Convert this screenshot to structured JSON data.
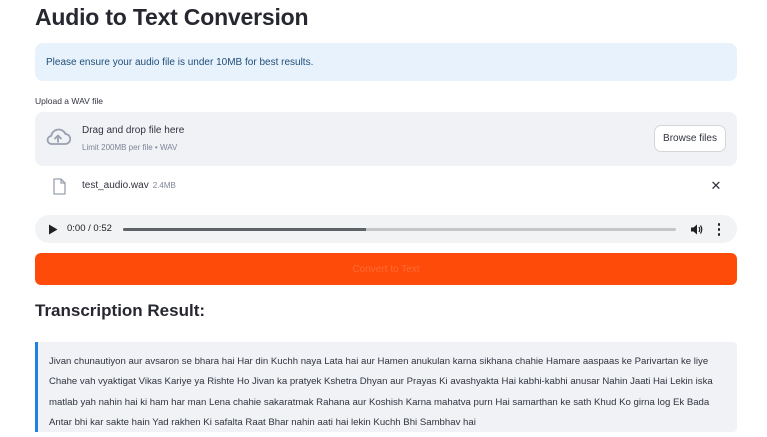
{
  "page": {
    "title": "Audio to Text Conversion",
    "info_message": "Please ensure your audio file is under 10MB for best results."
  },
  "uploader": {
    "label": "Upload a WAV file",
    "drag_text": "Drag and drop file here",
    "limit_text": "Limit 200MB per file • WAV",
    "browse_label": "Browse files",
    "icon": "cloud-upload-icon"
  },
  "file": {
    "name": "test_audio.wav",
    "size": "2.4MB",
    "icon": "file-icon",
    "remove_icon": "close-icon"
  },
  "player": {
    "time": "0:00 / 0:52",
    "progress": 0.44,
    "icons": [
      "play-icon",
      "volume-icon",
      "more-options-icon"
    ]
  },
  "convert": {
    "label": "Convert to Text"
  },
  "result": {
    "heading": "Transcription Result:",
    "text": "Jivan chunautiyon aur avsaron se bhara hai Har din Kuchh naya Lata hai aur Hamen anukulan karna sikhana chahie Hamare aaspaas ke Parivartan ke liye Chahe vah vyaktigat Vikas Kariye ya Rishte Ho Jivan ka pratyek Kshetra Dhyan aur Prayas Ki avashyakta Hai kabhi-kabhi anusar Nahin Jaati Hai Lekin iska matlab yah nahin hai ki ham har man Lena chahie sakaratmak Rahana aur Koshish Karna mahatva purn Hai samarthan ke sath Khud Ko girna log Ek Bada Antar bhi kar sakte hain Yad rakhen Ki safalta Raat Bhar nahin aati hai lekin Kuchh Bhi Sambhav hai"
  },
  "colors": {
    "primary": "#ff4b0a",
    "info_bg": "#e8f2fc",
    "info_text": "#1f4e79",
    "result_accent": "#1c83e1",
    "panel_bg": "#f0f2f6"
  }
}
